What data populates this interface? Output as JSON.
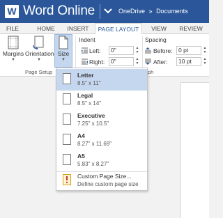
{
  "title_bar": {
    "app_title": "Word Online",
    "logo_letter": "W",
    "breadcrumb": [
      "OneDrive",
      "»",
      "Documents"
    ]
  },
  "tabs": [
    "FILE",
    "HOME",
    "INSERT",
    "PAGE LAYOUT",
    "VIEW",
    "REVIEW"
  ],
  "active_tab": "PAGE LAYOUT",
  "ribbon": {
    "margins_label": "Margins",
    "orientation_label": "Orientation",
    "size_label": "Size",
    "page_setup_group": "Page Setup",
    "paragraph_group_partial": "ph",
    "indent": {
      "title": "Indent",
      "left_label": "Left:",
      "left_value": "0\"",
      "right_label": "Right:",
      "right_value": "0\""
    },
    "spacing": {
      "title": "Spacing",
      "before_label": "Before:",
      "before_value": "0 pt",
      "after_label": "After:",
      "after_value": "10 pt"
    }
  },
  "size_menu": {
    "items": [
      {
        "name": "Letter",
        "dims": "8.5\" x 11\"",
        "selected": true
      },
      {
        "name": "Legal",
        "dims": "8.5\" x 14\"",
        "selected": false
      },
      {
        "name": "Executive",
        "dims": "7.25\" x 10.5\"",
        "selected": false
      },
      {
        "name": "A4",
        "dims": "8.27\" x 11.69\"",
        "selected": false
      },
      {
        "name": "A5",
        "dims": "5.83\" x 8.27\"",
        "selected": false
      }
    ],
    "custom": {
      "name": "Custom Page Size...",
      "description": "Define custom page size",
      "icon": "custom-size-icon"
    }
  },
  "colors": {
    "brand": "#2b579a",
    "selected_bg": "#c5d7ee",
    "ribbon_bg": "#ffffff",
    "app_bg": "#f2f2f2"
  }
}
